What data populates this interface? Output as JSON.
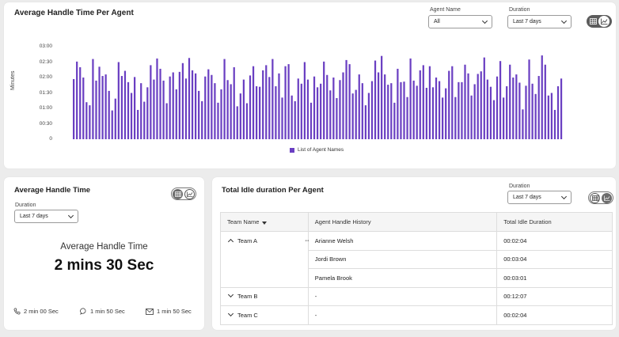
{
  "top_card": {
    "title": "Average Handle Time Per Agent",
    "agent_filter": {
      "label": "Agent Name",
      "value": "All"
    },
    "duration_filter": {
      "label": "Duration",
      "value": "Last 7 days"
    },
    "legend": "List of Agent Names"
  },
  "chart_data": {
    "type": "bar",
    "ylabel": "Minutes",
    "y_ticks": [
      "03:00",
      "02:30",
      "02:00",
      "01:30",
      "01:00",
      "00:30",
      "0"
    ],
    "ylim": [
      0,
      180
    ],
    "series": [
      {
        "name": "List of Agent Names",
        "color": "#6a3fc2",
        "values": [
          117,
          151,
          140,
          120,
          72,
          66,
          156,
          114,
          141,
          123,
          126,
          94,
          56,
          79,
          150,
          123,
          133,
          111,
          90,
          121,
          57,
          109,
          73,
          101,
          144,
          116,
          157,
          137,
          114,
          70,
          122,
          130,
          97,
          131,
          148,
          118,
          158,
          134,
          128,
          94,
          74,
          122,
          136,
          125,
          109,
          71,
          97,
          156,
          115,
          107,
          140,
          64,
          89,
          116,
          70,
          124,
          142,
          103,
          102,
          134,
          144,
          121,
          156,
          103,
          128,
          81,
          142,
          146,
          85,
          74,
          118,
          108,
          150,
          116,
          71,
          122,
          101,
          108,
          151,
          125,
          95,
          120,
          80,
          115,
          130,
          154,
          146,
          89,
          96,
          126,
          109,
          66,
          90,
          113,
          153,
          130,
          162,
          126,
          106,
          109,
          71,
          137,
          111,
          112,
          82,
          157,
          114,
          104,
          134,
          144,
          100,
          142,
          101,
          120,
          113,
          81,
          99,
          133,
          142,
          82,
          111,
          111,
          145,
          128,
          85,
          107,
          127,
          132,
          159,
          116,
          102,
          76,
          122,
          152,
          81,
          103,
          145,
          120,
          126,
          110,
          58,
          104,
          155,
          108,
          88,
          123,
          163,
          145,
          85,
          90,
          57,
          103,
          118
        ]
      }
    ]
  },
  "aht_card": {
    "title": "Average Handle Time",
    "duration_label": "Duration",
    "duration_value": "Last 7 days",
    "center_label": "Average Handle Time",
    "center_value": "2 mins 30 Sec",
    "stats": [
      {
        "icon": "phone-icon",
        "value": "2 min 00 Sec"
      },
      {
        "icon": "chat-icon",
        "value": "1 min 50 Sec"
      },
      {
        "icon": "email-icon",
        "value": "1 min 50 Sec"
      }
    ]
  },
  "idle_card": {
    "title": "Total Idle duration Per Agent",
    "duration_label": "Duration",
    "duration_value": "Last 7 days",
    "columns": [
      "Team Name",
      "Agent Handle History",
      "Total Idle Duration"
    ],
    "teams": [
      {
        "name": "Team A",
        "expanded": true,
        "rows": [
          {
            "agent": "Arianne Welsh",
            "duration": "00:02:04"
          },
          {
            "agent": "Jordi Brown",
            "duration": "00:03:04"
          },
          {
            "agent": "Pamela Brook",
            "duration": "00:03:01"
          }
        ]
      },
      {
        "name": "Team B",
        "expanded": false,
        "rows": [
          {
            "agent": "-",
            "duration": "00:12:07"
          }
        ]
      },
      {
        "name": "Team C",
        "expanded": false,
        "rows": [
          {
            "agent": "-",
            "duration": "00:02:04"
          }
        ]
      }
    ]
  }
}
